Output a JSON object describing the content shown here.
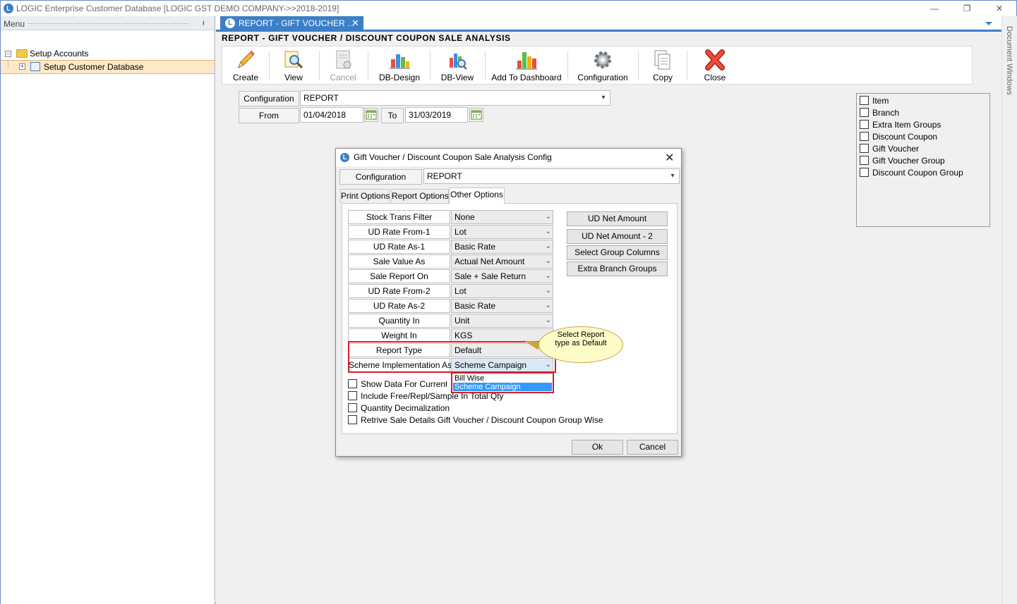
{
  "window": {
    "title": "LOGIC Enterprise Customer Database  [LOGIC GST DEMO COMPANY->>2018-2019]",
    "minimize": "—",
    "restore": "❐",
    "close": "✕"
  },
  "menu": {
    "label": "Menu",
    "pin": "ᵻ",
    "tree": [
      {
        "label": "Setup Accounts",
        "expander": "−",
        "icon": "folder-icon"
      },
      {
        "label": "Setup Customer Database",
        "expander": "+",
        "icon": "form-icon",
        "selected": true
      }
    ]
  },
  "tab": {
    "label": "REPORT - GIFT VOUCHER ...",
    "close": "✕",
    "logo": "L"
  },
  "report_title": "REPORT - GIFT VOUCHER / DISCOUNT COUPON SALE ANALYSIS",
  "toolbar": [
    {
      "label": "Create",
      "icon": "pencil-icon",
      "enabled": true
    },
    {
      "label": "View",
      "icon": "magnifier-icon",
      "enabled": true
    },
    {
      "label": "Cancel",
      "icon": "cancel-doc-icon",
      "enabled": false
    },
    {
      "label": "DB-Design",
      "icon": "db-design-icon",
      "enabled": true
    },
    {
      "label": "DB-View",
      "icon": "db-view-icon",
      "enabled": true
    },
    {
      "label": "Add To Dashboard",
      "icon": "bar-chart-icon",
      "enabled": true
    },
    {
      "label": "Configuration",
      "icon": "gear-icon",
      "enabled": true
    },
    {
      "label": "Copy",
      "icon": "copy-icon",
      "enabled": true
    },
    {
      "label": "Close",
      "icon": "red-x-icon",
      "enabled": true
    }
  ],
  "filters": {
    "configuration_label": "Configuration",
    "configuration_value": "REPORT",
    "from_label": "From",
    "from_value": "01/04/2018",
    "to_label": "To",
    "to_value": "31/03/2019"
  },
  "options": [
    "Item",
    "Branch",
    "Extra Item Groups",
    "Discount Coupon",
    "Gift Voucher",
    "Gift Voucher Group",
    "Discount Coupon Group"
  ],
  "document_windows": "Document Windows",
  "dialog": {
    "title": "Gift Voucher / Discount Coupon Sale Analysis Config",
    "close": "✕",
    "configuration_label": "Configuration",
    "configuration_value": "REPORT",
    "tabs": [
      "Print Options",
      "Report Options",
      "Other Options"
    ],
    "active_tab": "Other Options",
    "params": [
      {
        "label": "Stock Trans Filter",
        "value": "None",
        "dropdown": true
      },
      {
        "label": "UD Rate From-1",
        "value": "Lot",
        "dropdown": true
      },
      {
        "label": "UD Rate As-1",
        "value": "Basic Rate",
        "dropdown": true
      },
      {
        "label": "Sale Value As",
        "value": "Actual Net Amount",
        "dropdown": true
      },
      {
        "label": "Sale Report On",
        "value": "Sale + Sale  Return",
        "dropdown": true
      },
      {
        "label": "UD Rate From-2",
        "value": "Lot",
        "dropdown": true
      },
      {
        "label": "UD Rate As-2",
        "value": "Basic Rate",
        "dropdown": true
      },
      {
        "label": "Quantity In",
        "value": "Unit",
        "dropdown": true
      },
      {
        "label": "Weight In",
        "value": "KGS",
        "dropdown": false
      },
      {
        "label": "Report Type",
        "value": "Default",
        "dropdown": false
      },
      {
        "label": "Scheme Implementation As",
        "value": "Scheme Campaign",
        "dropdown": true,
        "open": true
      }
    ],
    "dropdown_options": [
      "Bill Wise",
      "Scheme Campaign"
    ],
    "dropdown_selected": "Scheme Campaign",
    "side_buttons": [
      "UD Net Amount",
      "UD Net Amount - 2",
      "Select Group Columns",
      "Extra Branch Groups"
    ],
    "checkboxes": [
      "Show Data For Current Bra",
      "Include Free/Repl/Sample In Total Qty",
      "Quantity Decimalization",
      "Retrive Sale Details Gift Voucher / Discount Coupon Group Wise"
    ],
    "ok": "Ok",
    "cancel": "Cancel"
  },
  "callout": {
    "line1": "Select Report",
    "line2": "type as Default"
  },
  "colors": {
    "accent": "#3c7fc7",
    "highlight_red": "#d0202a",
    "callout_bg": "#fefcc6",
    "selected_tree": "#fde8c8",
    "dropdown_sel": "#3399ff"
  }
}
